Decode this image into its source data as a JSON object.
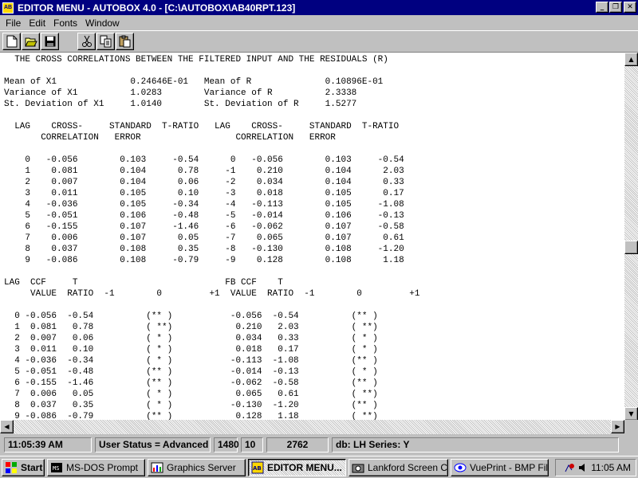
{
  "window": {
    "title": "EDITOR MENU - AUTOBOX 4.0 - [C:\\AUTOBOX\\AB40RPT.123]",
    "minimize": "_",
    "restore": "❐",
    "close": "✕"
  },
  "menu": [
    "File",
    "Edit",
    "Fonts",
    "Window"
  ],
  "toolbar": {
    "new": "new-file-icon",
    "open": "open-folder-icon",
    "save": "save-disk-icon",
    "cut": "scissors-icon",
    "copy": "copy-icon",
    "paste": "paste-icon"
  },
  "report_lines": [
    "  THE CROSS CORRELATIONS BETWEEN THE FILTERED INPUT AND THE RESIDUALS (R)",
    "",
    "Mean of X1              0.24646E-01   Mean of R              0.10896E-01",
    "Variance of X1          1.0283        Variance of R          2.3338",
    "St. Deviation of X1     1.0140        St. Deviation of R     1.5277",
    "",
    "  LAG    CROSS-     STANDARD  T-RATIO   LAG    CROSS-     STANDARD  T-RATIO",
    "       CORRELATION   ERROR                  CORRELATION   ERROR",
    "",
    "    0   -0.056        0.103     -0.54      0   -0.056        0.103     -0.54",
    "    1    0.081        0.104      0.78     -1    0.210        0.104      2.03",
    "    2    0.007        0.104      0.06     -2    0.034        0.104      0.33",
    "    3    0.011        0.105      0.10     -3    0.018        0.105      0.17",
    "    4   -0.036        0.105     -0.34     -4   -0.113        0.105     -1.08",
    "    5   -0.051        0.106     -0.48     -5   -0.014        0.106     -0.13",
    "    6   -0.155        0.107     -1.46     -6   -0.062        0.107     -0.58",
    "    7    0.006        0.107      0.05     -7    0.065        0.107      0.61",
    "    8    0.037        0.108      0.35     -8   -0.130        0.108     -1.20",
    "    9   -0.086        0.108     -0.79     -9    0.128        0.108      1.18",
    "",
    "LAG  CCF     T                            FB CCF    T",
    "     VALUE  RATIO  -1        0         +1  VALUE  RATIO  -1        0         +1",
    "",
    "  0 -0.056  -0.54          (** )           -0.056  -0.54          (** )",
    "  1  0.081   0.78          ( **)            0.210   2.03          ( **)",
    "  2  0.007   0.06          ( * )            0.034   0.33          ( * )",
    "  3  0.011   0.10          ( * )            0.018   0.17          ( * )",
    "  4 -0.036  -0.34          ( * )           -0.113  -1.08          (** )",
    "  5 -0.051  -0.48          (** )           -0.014  -0.13          ( * )",
    "  6 -0.155  -1.46          (** )           -0.062  -0.58          (** )",
    "  7  0.006   0.05          ( * )            0.065   0.61          ( **)",
    "  8  0.037   0.35          ( * )           -0.130  -1.20          (** )",
    "  9 -0.086  -0.79          (** )            0.128   1.18          ( **)"
  ],
  "status": {
    "time": "11:05:39 AM",
    "user_status": "User Status = Advanced",
    "field1": "1480",
    "field2": "10",
    "field3": "2762",
    "db": "db: LH Series: Y"
  },
  "taskbar": {
    "start": "Start",
    "items": [
      {
        "label": "MS-DOS Prompt",
        "active": false
      },
      {
        "label": "Graphics Server",
        "active": false
      },
      {
        "label": "EDITOR MENU...",
        "active": true
      },
      {
        "label": "Lankford Screen C...",
        "active": false
      },
      {
        "label": "VuePrint - BMP File...",
        "active": false
      }
    ],
    "clock": "11:05 AM"
  }
}
